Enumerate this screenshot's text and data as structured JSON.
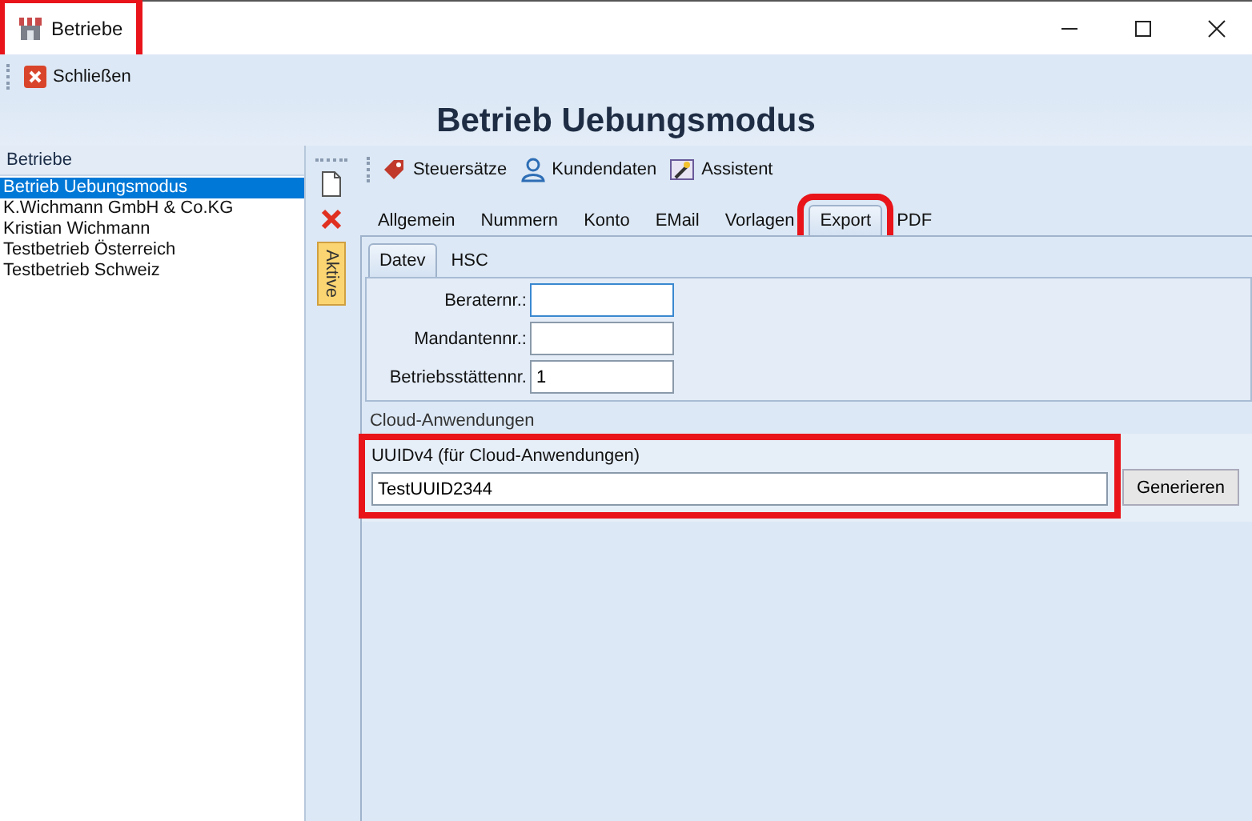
{
  "window": {
    "title": "Betriebe",
    "highlighted": true
  },
  "toolbar": {
    "close_label": "Schließen"
  },
  "header": {
    "title": "Betrieb Uebungsmodus"
  },
  "list": {
    "heading": "Betriebe",
    "items": [
      {
        "label": "Betrieb Uebungsmodus",
        "selected": true
      },
      {
        "label": "K.Wichmann GmbH & Co.KG",
        "selected": false
      },
      {
        "label": "Kristian Wichmann",
        "selected": false
      },
      {
        "label": "Testbetrieb Österreich",
        "selected": false
      },
      {
        "label": "Testbetrieb Schweiz",
        "selected": false
      }
    ]
  },
  "side_tab": {
    "label": "Aktive"
  },
  "actions": [
    {
      "label": "Steuersätze",
      "kind": "tax"
    },
    {
      "label": "Kundendaten",
      "kind": "person"
    },
    {
      "label": "Assistent",
      "kind": "wizard"
    }
  ],
  "tabs": [
    {
      "label": "Allgemein",
      "selected": false,
      "highlighted": false
    },
    {
      "label": "Nummern",
      "selected": false,
      "highlighted": false
    },
    {
      "label": "Konto",
      "selected": false,
      "highlighted": false
    },
    {
      "label": "EMail",
      "selected": false,
      "highlighted": false
    },
    {
      "label": "Vorlagen",
      "selected": false,
      "highlighted": false
    },
    {
      "label": "Export",
      "selected": true,
      "highlighted": true
    },
    {
      "label": "PDF",
      "selected": false,
      "highlighted": false
    }
  ],
  "subtabs": [
    {
      "label": "Datev",
      "selected": true
    },
    {
      "label": "HSC",
      "selected": false
    }
  ],
  "fields": [
    {
      "label": "Beraternr.:",
      "focused": true
    },
    {
      "label": "Mandantennr.:",
      "focused": false
    },
    {
      "label": "Betriebsstättennr.",
      "value": "1",
      "focused": false
    }
  ],
  "cloud": {
    "title": "Cloud-Anwendungen",
    "label": "UUIDv4 (für Cloud-Anwendungen)",
    "value": "TestUUID2344",
    "button": "Generieren",
    "highlighted": true
  }
}
